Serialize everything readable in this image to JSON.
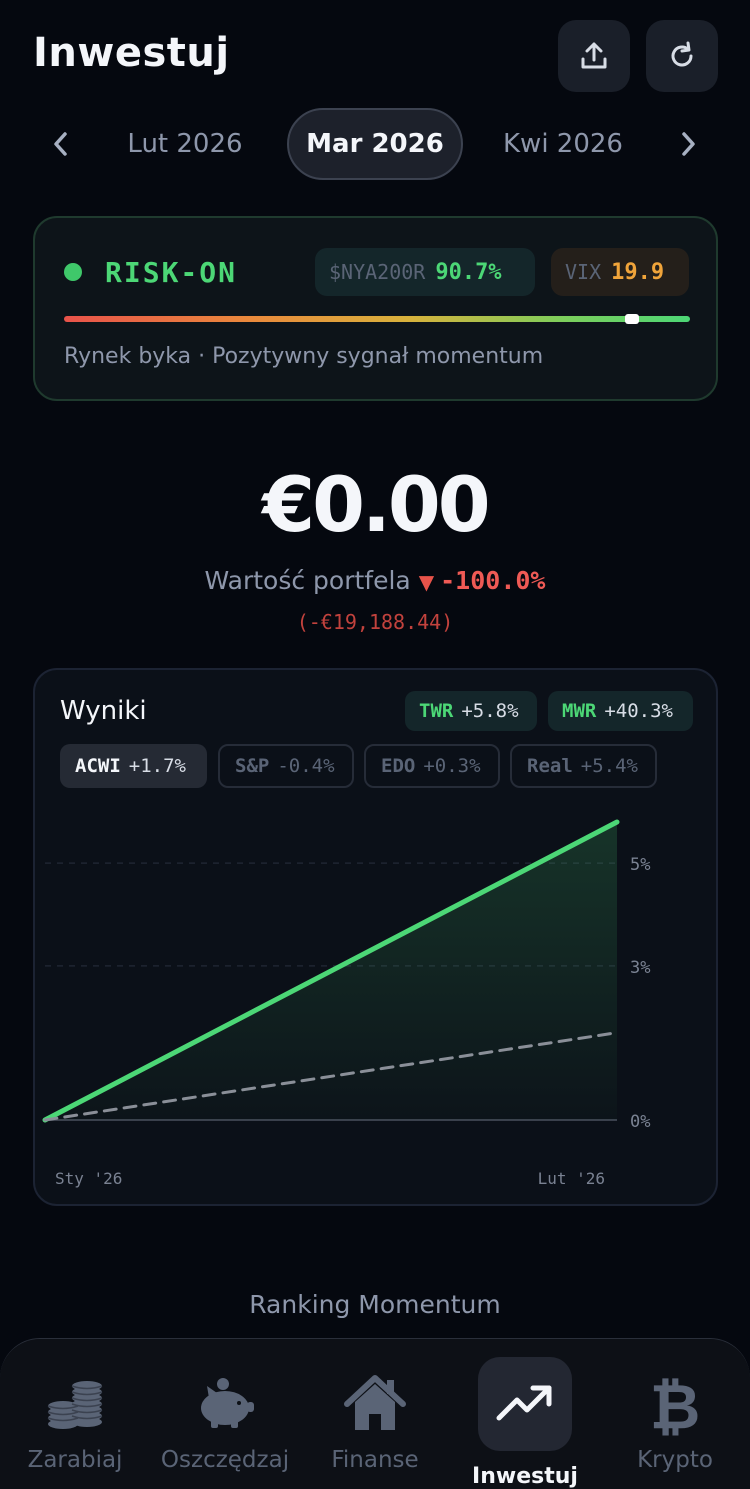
{
  "header": {
    "title": "Inwestuj",
    "share_icon": "upload-icon",
    "refresh_icon": "refresh-icon"
  },
  "month_nav": {
    "prev": "Lut 2026",
    "current": "Mar 2026",
    "next": "Kwi 2026"
  },
  "risk": {
    "label": "RISK-ON",
    "nya_key": "$NYA200R",
    "nya_value": "90.7%",
    "nya_fraction": 0.907,
    "vix_key": "VIX",
    "vix_value": "19.9",
    "description": "Rynek byka · Pozytywny sygnał momentum",
    "status_color": "#4cd776"
  },
  "portfolio": {
    "amount": "€0.00",
    "label": "Wartość portfela",
    "arrow": "▼",
    "change_pct": "-100.0%",
    "change_abs": "(-€19,188.44)"
  },
  "results": {
    "title": "Wyniki",
    "twr_label": "TWR",
    "twr_value": "+5.8%",
    "mwr_label": "MWR",
    "mwr_value": "+40.3%",
    "benchmarks": [
      {
        "label": "ACWI",
        "value": "+1.7%",
        "active": true
      },
      {
        "label": "S&P",
        "value": "-0.4%",
        "active": false
      },
      {
        "label": "EDO",
        "value": "+0.3%",
        "active": false
      },
      {
        "label": "Real",
        "value": "+5.4%",
        "active": false
      }
    ]
  },
  "chart_data": {
    "type": "line",
    "x": [
      "Sty '26",
      "Lut '26"
    ],
    "x_tick_labels": [
      "Sty '26",
      "Lut '26"
    ],
    "y_tick_labels": [
      "5%",
      "3%",
      "0%"
    ],
    "y_ticks": [
      5,
      3,
      0
    ],
    "ylim": [
      0,
      5.8
    ],
    "series": [
      {
        "name": "TWR",
        "values": [
          0,
          5.8
        ],
        "color": "#4cd776",
        "fill": true
      },
      {
        "name": "ACWI",
        "values": [
          0,
          1.7
        ],
        "color": "#8a8f98",
        "dashed": true
      }
    ]
  },
  "ranking": {
    "title": "Ranking Momentum"
  },
  "bottom_nav": {
    "items": [
      {
        "label": "Zarabiaj",
        "icon": "coins-icon",
        "active": false
      },
      {
        "label": "Oszczędzaj",
        "icon": "piggy-bank-icon",
        "active": false
      },
      {
        "label": "Finanse",
        "icon": "home-icon",
        "active": false
      },
      {
        "label": "Inwestuj",
        "icon": "trending-up-icon",
        "active": true
      },
      {
        "label": "Krypto",
        "icon": "bitcoin-icon",
        "active": false
      }
    ]
  }
}
